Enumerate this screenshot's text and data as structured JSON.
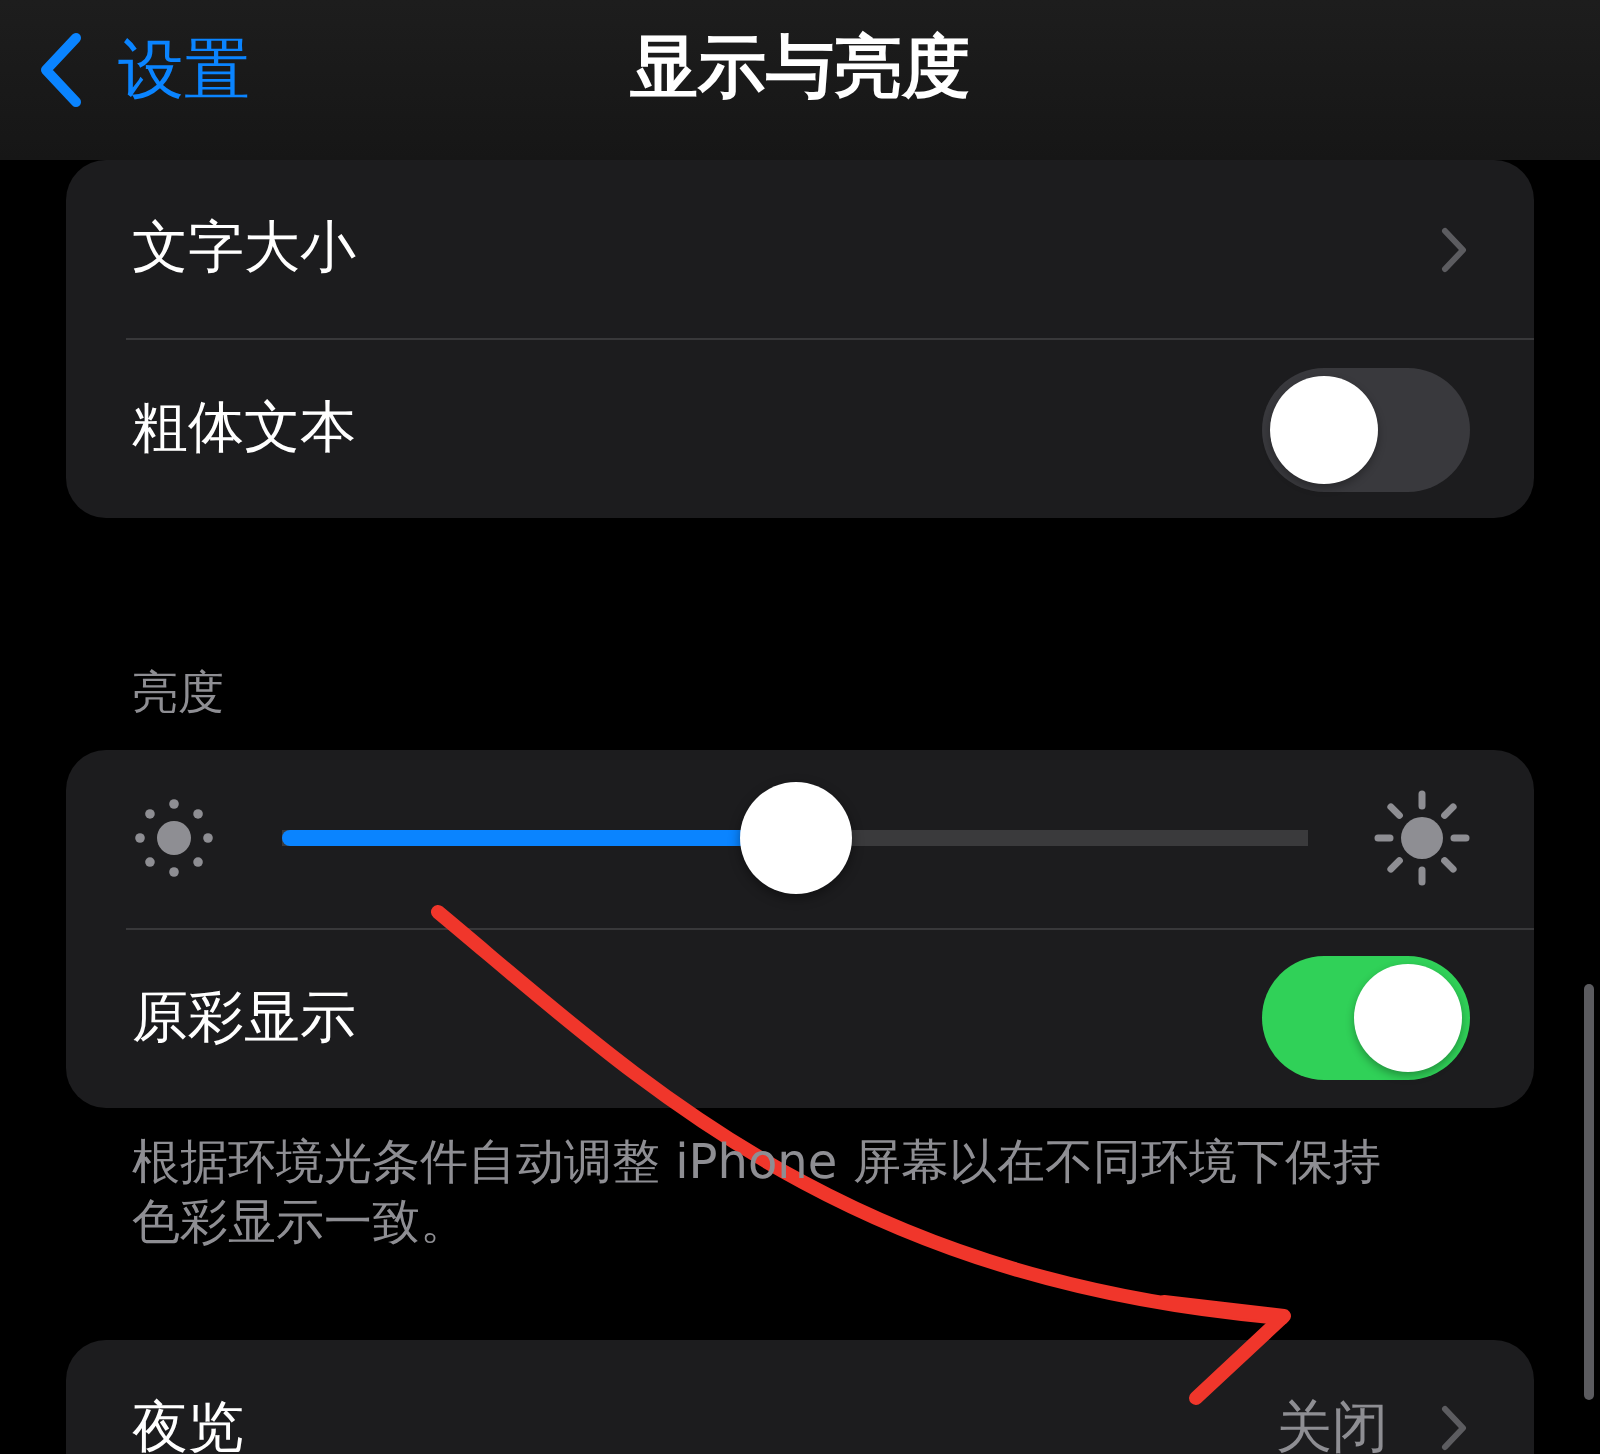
{
  "nav_bar": {
    "back_label": "设置",
    "title": "显示与亮度"
  },
  "groups": [
    {
      "rows": [
        {
          "kind": "link",
          "label": "文字大小"
        },
        {
          "kind": "toggle",
          "label": "粗体文本",
          "on": false
        }
      ]
    },
    {
      "header": "亮度",
      "rows": [
        {
          "kind": "slider",
          "level": 0.5
        },
        {
          "kind": "toggle",
          "label": "原彩显示",
          "on": true
        }
      ],
      "footer": "根据环境光条件自动调整 iPhone 屏幕以在不同环境下保持色彩显示一致。"
    },
    {
      "rows": [
        {
          "kind": "link",
          "label": "夜览",
          "value": "关闭"
        }
      ]
    }
  ]
}
